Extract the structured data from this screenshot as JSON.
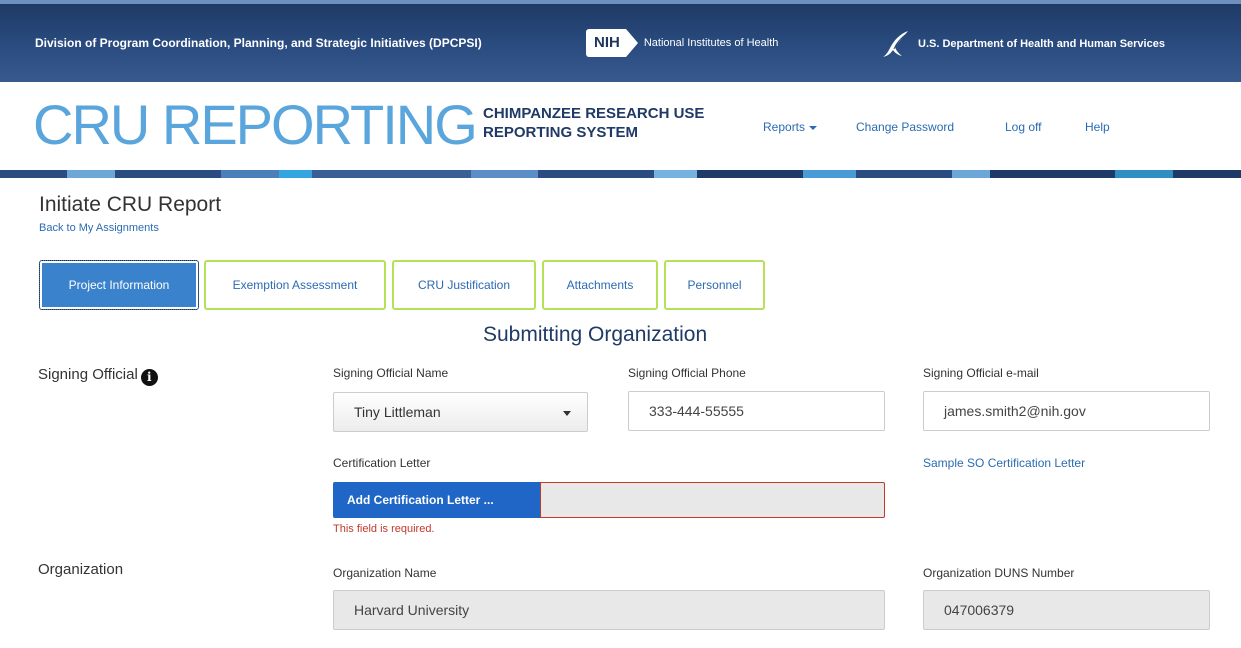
{
  "banner": {
    "division": "Division of Program Coordination, Planning, and Strategic Initiatives (DPCPSI)",
    "nih_abbrev": "NIH",
    "nih_name": "National Institutes of Health",
    "hhs_name": "U.S. Department of Health and Human Services"
  },
  "header": {
    "brand": "CRU REPORTING",
    "subtitle_line1": "CHIMPANZEE RESEARCH USE",
    "subtitle_line2": "REPORTING SYSTEM",
    "nav": {
      "reports": "Reports",
      "change_password": "Change Password",
      "log_off": "Log off",
      "help": "Help"
    }
  },
  "stripe_colors": [
    "#2a4c80",
    "#6da7d8",
    "#2a4c80",
    "#4a7fba",
    "#33a5e0",
    "#3a5f96",
    "#5c8fc7",
    "#2a4c80",
    "#76b2e0",
    "#1f3a66",
    "#4a9ad6",
    "#2a4c80",
    "#6da7d8",
    "#1f3a66",
    "#2f8fc2",
    "#1f3a66"
  ],
  "page": {
    "title": "Initiate CRU Report",
    "back_link": "Back to My Assignments"
  },
  "tabs": [
    {
      "label": "Project Information",
      "active": true
    },
    {
      "label": "Exemption Assessment",
      "active": false
    },
    {
      "label": "CRU Justification",
      "active": false
    },
    {
      "label": "Attachments",
      "active": false
    },
    {
      "label": "Personnel",
      "active": false
    }
  ],
  "section": {
    "title": "Submitting Organization"
  },
  "signing_official": {
    "row_label": "Signing Official",
    "info_glyph": "i",
    "name_label": "Signing Official Name",
    "name_value": "Tiny Littleman",
    "phone_label": "Signing Official Phone",
    "phone_value": "333-444-55555",
    "email_label": "Signing Official e-mail",
    "email_value": "james.smith2@nih.gov",
    "cert_label": "Certification Letter",
    "cert_button": "Add Certification Letter ...",
    "cert_error": "This field is required.",
    "sample_link": "Sample SO Certification Letter"
  },
  "organization": {
    "row_label": "Organization",
    "name_label": "Organization Name",
    "name_value": "Harvard University",
    "duns_label": "Organization DUNS Number",
    "duns_value": "047006379"
  }
}
